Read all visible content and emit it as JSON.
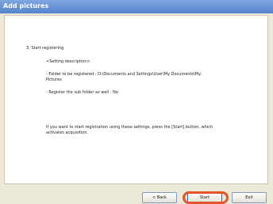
{
  "window": {
    "title": "Add pictures"
  },
  "content": {
    "step_heading": "3. Start registering",
    "description_label": "<Setting description>",
    "folder_line1": "- Folder to be registered :  D:\\Documents and Settings\\User\\My Documents\\My",
    "folder_line2": "Pictures",
    "subfolder_line": "- Register the sub folder as well :  No",
    "instruction_line1": "If you want to start registration using these settings, press the [Start] button, which",
    "instruction_line2": "activates acquisition."
  },
  "buttons": {
    "back_label": "< Back",
    "start_label": "Start",
    "exit_label": "Exit"
  },
  "colors": {
    "title_bar": "#6b93d6",
    "highlight": "#e4542a"
  }
}
